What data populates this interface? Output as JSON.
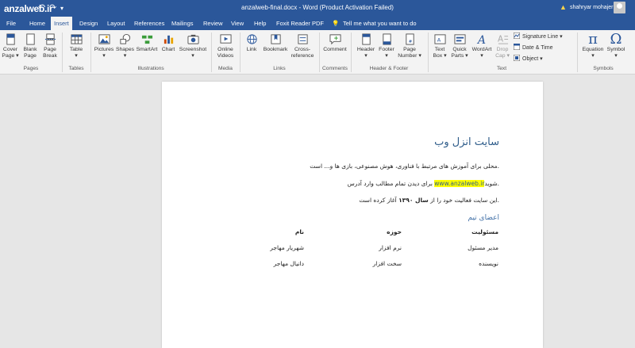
{
  "titlebar": {
    "app_logo": "anzalweb.ir",
    "document_title": "anzalweb-final.docx  -  Word (Product Activation Failed)",
    "user_name": "shahryar mohajer",
    "icons": [
      "save-icon",
      "undo-icon",
      "redo-icon",
      "customize-icon",
      "warning-icon",
      "avatar"
    ]
  },
  "tabs": [
    "File",
    "Home",
    "Insert",
    "Design",
    "Layout",
    "References",
    "Mailings",
    "Review",
    "View",
    "Help",
    "Foxit Reader PDF"
  ],
  "active_tab": "Insert",
  "tell_me": "Tell me what you want to do",
  "ribbon": {
    "pages": {
      "label": "Pages",
      "cover": "Cover\nPage",
      "blank": "Blank\nPage",
      "break": "Page\nBreak"
    },
    "tables": {
      "label": "Tables",
      "table": "Table"
    },
    "illustrations": {
      "label": "Illustrations",
      "pictures": "Pictures",
      "shapes": "Shapes",
      "smartart": "SmartArt",
      "chart": "Chart",
      "screenshot": "Screenshot"
    },
    "media": {
      "label": "Media",
      "online_videos": "Online\nVideos"
    },
    "links": {
      "label": "Links",
      "link": "Link",
      "bookmark": "Bookmark",
      "cross": "Cross-\nreference"
    },
    "comments": {
      "label": "Comments",
      "comment": "Comment"
    },
    "header_footer": {
      "label": "Header & Footer",
      "header": "Header",
      "footer": "Footer",
      "page_number": "Page\nNumber"
    },
    "text": {
      "label": "Text",
      "text_box": "Text\nBox",
      "quick_parts": "Quick\nParts",
      "wordart": "WordArt",
      "drop_cap": "Drop\nCap",
      "signature_line": "Signature Line",
      "date_time": "Date & Time",
      "object": "Object"
    },
    "symbols": {
      "label": "Symbols",
      "equation": "Equation",
      "symbol": "Symbol"
    }
  },
  "document": {
    "title": "سایت انزل وب",
    "p1": ".محلی برای آموزش های مرتبط با فناوری، هوش مصنوعی، بازی ها و... است",
    "p2_before": ".شوید",
    "p2_link": "www.anzalweb.ir",
    "p2_after": "برای دیدن تمام مطالب وارد آدرس",
    "p3_pre": ".این سایت فعالیت خود را از",
    "p3_bold": "سال ۱۳۹۰",
    "p3_post": "آغاز کرده است",
    "team_heading": "اعضای تیم",
    "table": {
      "headers": [
        "مسئولیت",
        "حوزه",
        "نام"
      ],
      "rows": [
        [
          "مدیر مسئول",
          "نرم افزار",
          "شهریار مهاجر"
        ],
        [
          "نویسنده",
          "سخت افزار",
          "دانیال مهاجر"
        ]
      ]
    }
  }
}
